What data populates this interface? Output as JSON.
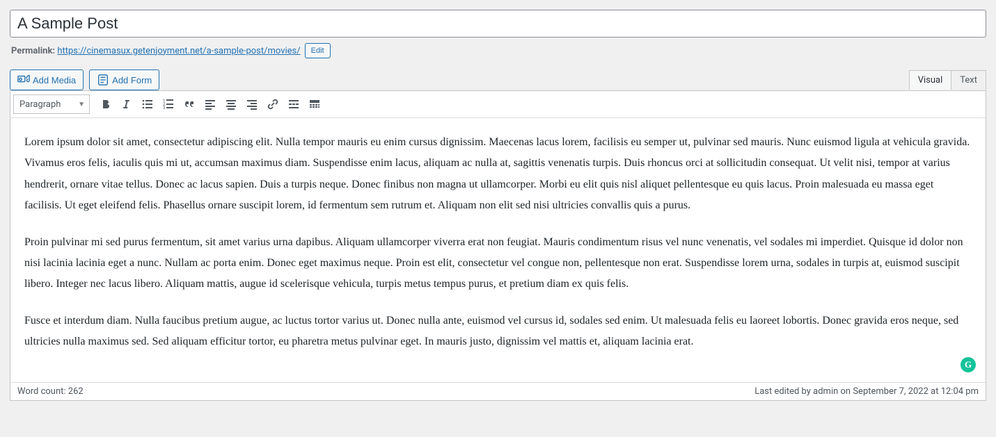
{
  "title": "A Sample Post",
  "permalink": {
    "label": "Permalink: ",
    "url_pre": "https://cinemasux.getenjoyment.net/",
    "slug": "a-sample-post",
    "url_post": "/movies/",
    "edit_label": "Edit"
  },
  "buttons": {
    "add_media": "Add Media",
    "add_form": "Add Form"
  },
  "tabs": {
    "visual": "Visual",
    "text": "Text"
  },
  "toolbar": {
    "format": "Paragraph"
  },
  "content": {
    "p1": "Lorem ipsum dolor sit amet, consectetur adipiscing elit. Nulla tempor mauris eu enim cursus dignissim. Maecenas lacus lorem, facilisis eu semper ut, pulvinar sed mauris. Nunc euismod ligula at vehicula gravida. Vivamus eros felis, iaculis quis mi ut, accumsan maximus diam. Suspendisse enim lacus, aliquam ac nulla at, sagittis venenatis turpis. Duis rhoncus orci at sollicitudin consequat. Ut velit nisi, tempor at varius hendrerit, ornare vitae tellus. Donec ac lacus sapien. Duis a turpis neque. Donec finibus non magna ut ullamcorper. Morbi eu elit quis nisl aliquet pellentesque eu quis lacus. Proin malesuada eu massa eget facilisis. Ut eget eleifend felis. Phasellus ornare suscipit lorem, id fermentum sem rutrum et. Aliquam non elit sed nisi ultricies convallis quis a purus.",
    "p2": "Proin pulvinar mi sed purus fermentum, sit amet varius urna dapibus. Aliquam ullamcorper viverra erat non feugiat. Mauris condimentum risus vel nunc venenatis, vel sodales mi imperdiet. Quisque id dolor non nisi lacinia lacinia eget a nunc. Nullam ac porta enim. Donec eget maximus neque. Proin est elit, consectetur vel congue non, pellentesque non erat. Suspendisse lorem urna, sodales in turpis at, euismod suscipit libero. Integer nec lacus libero. Aliquam mattis, augue id scelerisque vehicula, turpis metus tempus purus, et pretium diam ex quis felis.",
    "p3": "Fusce et interdum diam. Nulla faucibus pretium augue, ac luctus tortor varius ut. Donec nulla ante, euismod vel cursus id, sodales sed enim. Ut malesuada felis eu laoreet lobortis. Donec gravida eros neque, sed ultricies nulla maximus sed. Sed aliquam efficitur tortor, eu pharetra metus pulvinar eget. In mauris justo, dignissim vel mattis et, aliquam lacinia erat."
  },
  "status": {
    "word_count": "Word count: 262",
    "last_edited": "Last edited by admin on September 7, 2022 at 12:04 pm"
  },
  "grammar_badge": "G"
}
